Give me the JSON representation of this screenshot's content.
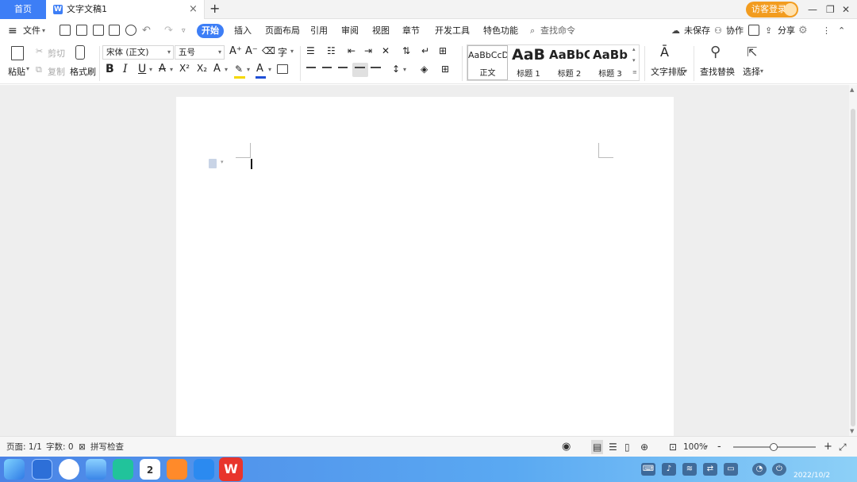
{
  "tabs": {
    "home": "首页",
    "doc_title": "文字文稿1",
    "doc_icon_letter": "W",
    "close": "×",
    "add": "+",
    "login": "访客登录"
  },
  "menu": {
    "hamburger": "≡",
    "file": "文件",
    "items": [
      "开始",
      "插入",
      "页面布局",
      "引用",
      "审阅",
      "视图",
      "章节",
      "开发工具",
      "特色功能"
    ],
    "search_placeholder": "查找命令",
    "unsaved": "未保存",
    "collab": "协作",
    "share": "分享"
  },
  "ribbon": {
    "paste": "粘贴",
    "cut": "剪切",
    "copy": "复制",
    "format_painter": "格式刷",
    "font_name": "宋体 (正文)",
    "font_size": "五号",
    "bold": "B",
    "italic": "I",
    "underline": "U",
    "strike": "A",
    "superscript": "X²",
    "subscript": "X₂",
    "styles": [
      {
        "preview": "AaBbCcD",
        "name": "正文"
      },
      {
        "preview": "AaB",
        "name": "标题 1"
      },
      {
        "preview": "AaBbC",
        "name": "标题 2"
      },
      {
        "preview": "AaBb",
        "name": "标题 3"
      }
    ],
    "text_layout": "文字排版",
    "find_replace": "查找替换",
    "select": "选择"
  },
  "statusbar": {
    "page": "页面: 1/1",
    "wordcount": "字数: 0",
    "spellcheck": "拼写检查",
    "zoom": "100%",
    "zoom_minus": "-",
    "zoom_plus": "+"
  },
  "taskbar": {
    "calendar_day": "2",
    "date": "2022/10/2",
    "wps_letter": "W"
  },
  "colors": {
    "accent": "#3d7ef6",
    "login": "#f29c1f",
    "highlight": "#f5d800",
    "font_color": "#1f4fd6"
  }
}
